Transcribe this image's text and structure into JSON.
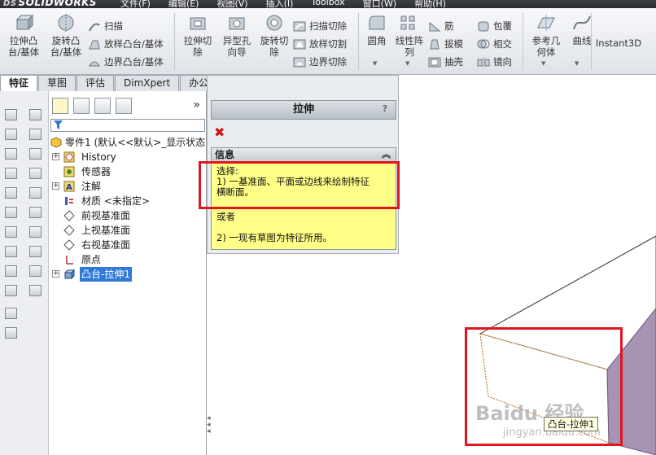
{
  "app": {
    "brand_prefix": "DS",
    "brand_name": "SOLIDWORKS"
  },
  "menu": [
    "文件(F)",
    "编辑(E)",
    "视图(V)",
    "插入(I)",
    "Toolbox",
    "窗口(W)",
    "帮助(H)"
  ],
  "commands": {
    "extrude_boss": "拉伸凸\n台/基体",
    "revolve_boss": "旋转凸\n台/基体",
    "sweep": "扫描",
    "loft_boss": "放样凸台/基体",
    "boundary_boss": "边界凸台/基体",
    "extrude_cut": "拉伸切\n除",
    "hole_wizard": "异型孔\n向导",
    "revolve_cut": "旋转切\n除",
    "sweep_cut": "扫描切除",
    "loft_cut": "放样切割",
    "boundary_cut": "边界切除",
    "fillet": "圆角",
    "linear_pattern": "线性阵\n列",
    "rib": "筋",
    "draft": "拔模",
    "shell": "抽壳",
    "wrap": "包覆",
    "intersect": "相交",
    "mirror": "镜向",
    "ref_geometry": "参考几\n何体",
    "curves": "曲线",
    "instant3d": "Instant3D"
  },
  "tabs": [
    {
      "label": "特征",
      "active": true
    },
    {
      "label": "草图",
      "active": false
    },
    {
      "label": "评估",
      "active": false
    },
    {
      "label": "DimXpert",
      "active": false
    },
    {
      "label": "办公室产品",
      "active": false
    }
  ],
  "tree": {
    "chevron": "»",
    "root": "零件1 (默认<<默认>_显示状态",
    "items": [
      {
        "label": "History",
        "expandable": true,
        "icon": "history-icon"
      },
      {
        "label": "传感器",
        "expandable": false,
        "icon": "sensor-icon"
      },
      {
        "label": "注解",
        "expandable": true,
        "icon": "annotation-icon"
      },
      {
        "label": "材质 <未指定>",
        "expandable": false,
        "icon": "material-icon"
      },
      {
        "label": "前视基准面",
        "expandable": false,
        "icon": "plane-icon"
      },
      {
        "label": "上视基准面",
        "expandable": false,
        "icon": "plane-icon"
      },
      {
        "label": "右视基准面",
        "expandable": false,
        "icon": "plane-icon"
      },
      {
        "label": "原点",
        "expandable": false,
        "icon": "origin-icon"
      },
      {
        "label": "凸台-拉伸1",
        "expandable": true,
        "icon": "extrude-feature-icon",
        "selected": true
      }
    ]
  },
  "property_manager": {
    "title": "拉伸",
    "help": "?",
    "cancel": "✖",
    "info_title": "信息",
    "info_collapse": "︽",
    "info_lines": [
      "选择:",
      "1) 一基准面、平面或边线来绘制特征",
      "横断面。",
      "",
      "或者",
      "",
      "2) 一现有草图为特征所用。"
    ]
  },
  "viewport": {
    "feature_tag": "凸台-拉伸1"
  },
  "watermark": {
    "main": "Baidu 经验",
    "sub": "jingyan.baidu.com"
  },
  "colors": {
    "highlight": "#e0151d",
    "info_bg": "#ffff88",
    "selection": "#2f7ad7"
  }
}
